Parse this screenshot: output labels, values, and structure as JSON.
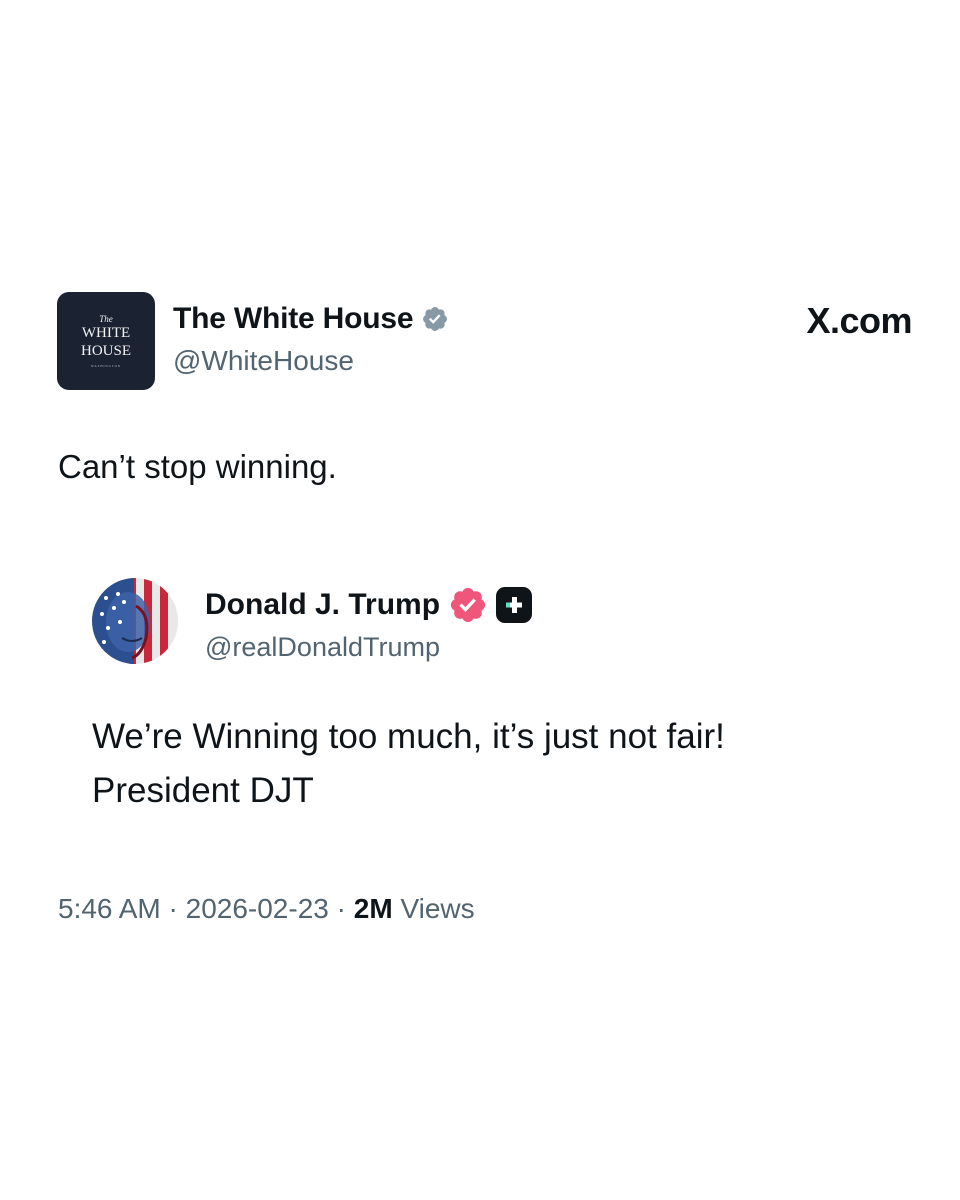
{
  "author": {
    "name": "The White House",
    "handle": "@WhiteHouse",
    "avatar_lines": [
      "The",
      "WHITE",
      "HOUSE",
      "WASHINGTON"
    ],
    "verified_badge": "gray-check-badge-icon"
  },
  "site": "X.com",
  "tweet_text": "Can’t stop winning.",
  "quoted": {
    "name": "Donald J. Trump",
    "handle": "@realDonaldTrump",
    "verified_badge": "pink-check-badge-icon",
    "platform_icon": "truth-social-icon",
    "text_lines": [
      "We’re Winning too much, it’s just not fair!",
      "President DJT"
    ]
  },
  "meta": {
    "time": "5:46 AM",
    "separator": "·",
    "date": "2026-02-23",
    "views_count": "2M",
    "views_label": "Views"
  },
  "colors": {
    "text": "#0f1419",
    "muted": "#536471",
    "avatar_bg": "#1b2232",
    "gray_badge": "#8899a6",
    "pink_badge": "#f0557a"
  }
}
